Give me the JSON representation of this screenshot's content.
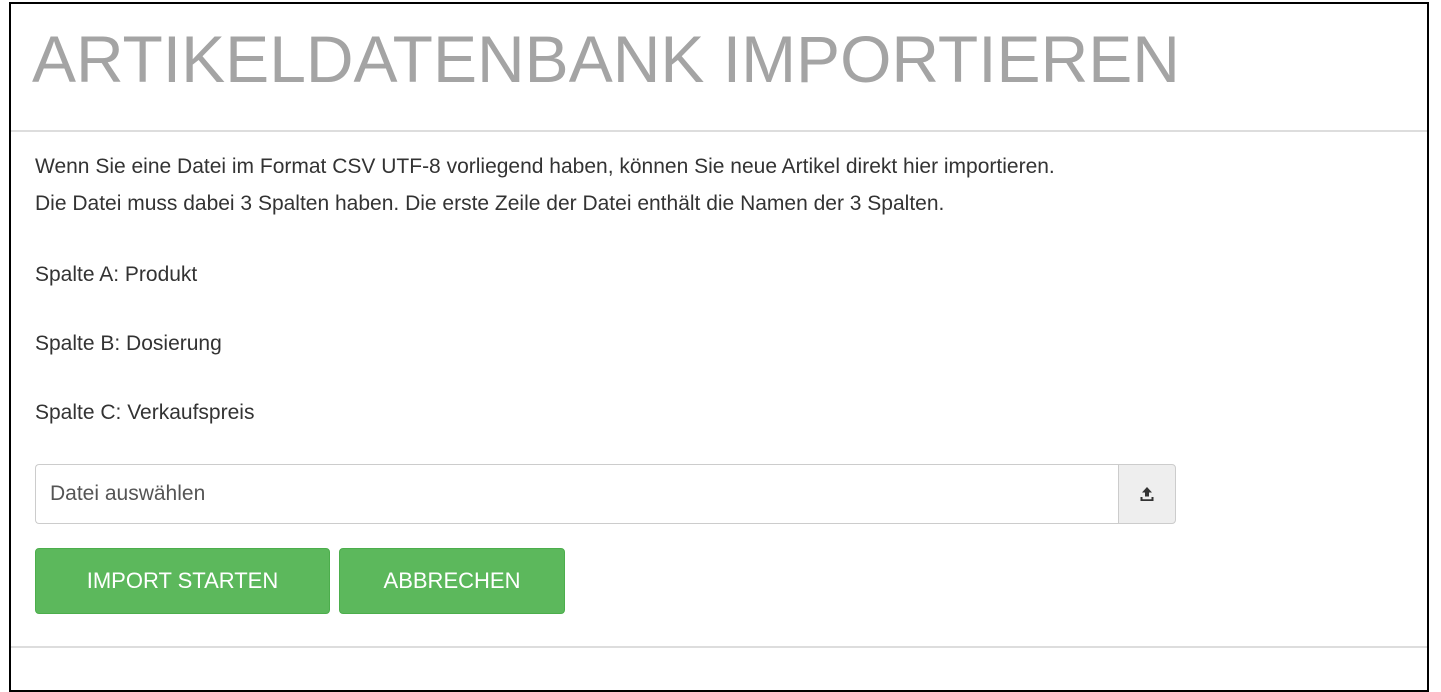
{
  "header": {
    "title": "ARTIKELDATENBANK IMPORTIEREN"
  },
  "description": {
    "line1": "Wenn Sie eine Datei im Format CSV UTF-8 vorliegend haben, können Sie neue Artikel direkt hier importieren.",
    "line2": "Die Datei muss dabei 3 Spalten haben. Die erste Zeile der Datei enthält die Namen der 3 Spalten."
  },
  "columns": [
    "Spalte A: Produkt",
    "Spalte B: Dosierung",
    "Spalte C: Verkaufspreis"
  ],
  "file_picker": {
    "placeholder": "Datei auswählen",
    "icon": "upload-icon"
  },
  "buttons": {
    "import_label": "IMPORT STARTEN",
    "cancel_label": "ABBRECHEN"
  },
  "colors": {
    "title": "#a4a4a4",
    "button_green": "#5cb85c",
    "text": "#333333",
    "divider": "#dddddd"
  }
}
